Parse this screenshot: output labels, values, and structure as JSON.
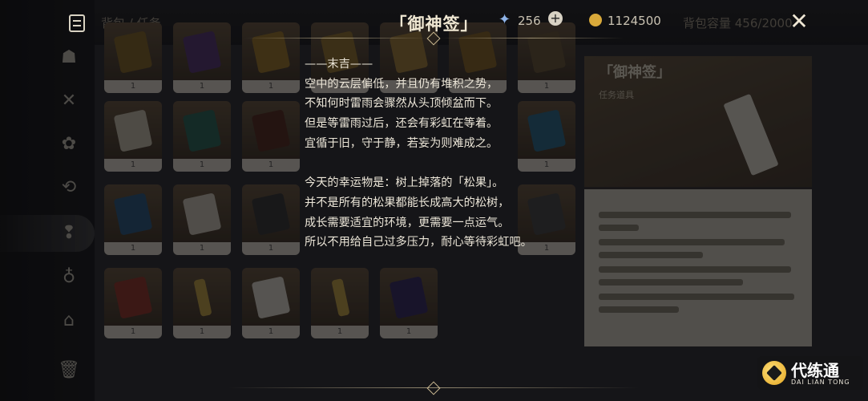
{
  "background": {
    "breadcrumb": "背包 / 任务",
    "capacity": "背包容量 456/2000",
    "slot_count_label": "1",
    "detail": {
      "title": "「御神签」",
      "subtitle": "任务道具"
    }
  },
  "header": {
    "title": "「御神签」",
    "resources": [
      {
        "icon": "primogem-icon",
        "value": "256"
      },
      {
        "icon": "mora-coin-icon",
        "value": "1124500"
      }
    ]
  },
  "fortune": {
    "heading": "——末吉——",
    "paragraph1": [
      "空中的云层偏低，并且仍有堆积之势，",
      "不知何时雷雨会骤然从头顶倾盆而下。",
      "但是等雷雨过后，还会有彩虹在等着。",
      "宜循于旧，守于静，若妄为则难成之。"
    ],
    "paragraph2": [
      "今天的幸运物是：树上掉落的「松果」。",
      "并不是所有的松果都能长成高大的松树，",
      "成长需要适宜的环境，更需要一点运气。",
      "所以不用给自己过多压力，耐心等待彩虹吧。"
    ]
  },
  "watermark": {
    "name_cn": "代练通",
    "name_en": "DAI LIAN TONG"
  },
  "colors": {
    "text": "#ece6d8",
    "accent_gold": "#cdbb93"
  }
}
